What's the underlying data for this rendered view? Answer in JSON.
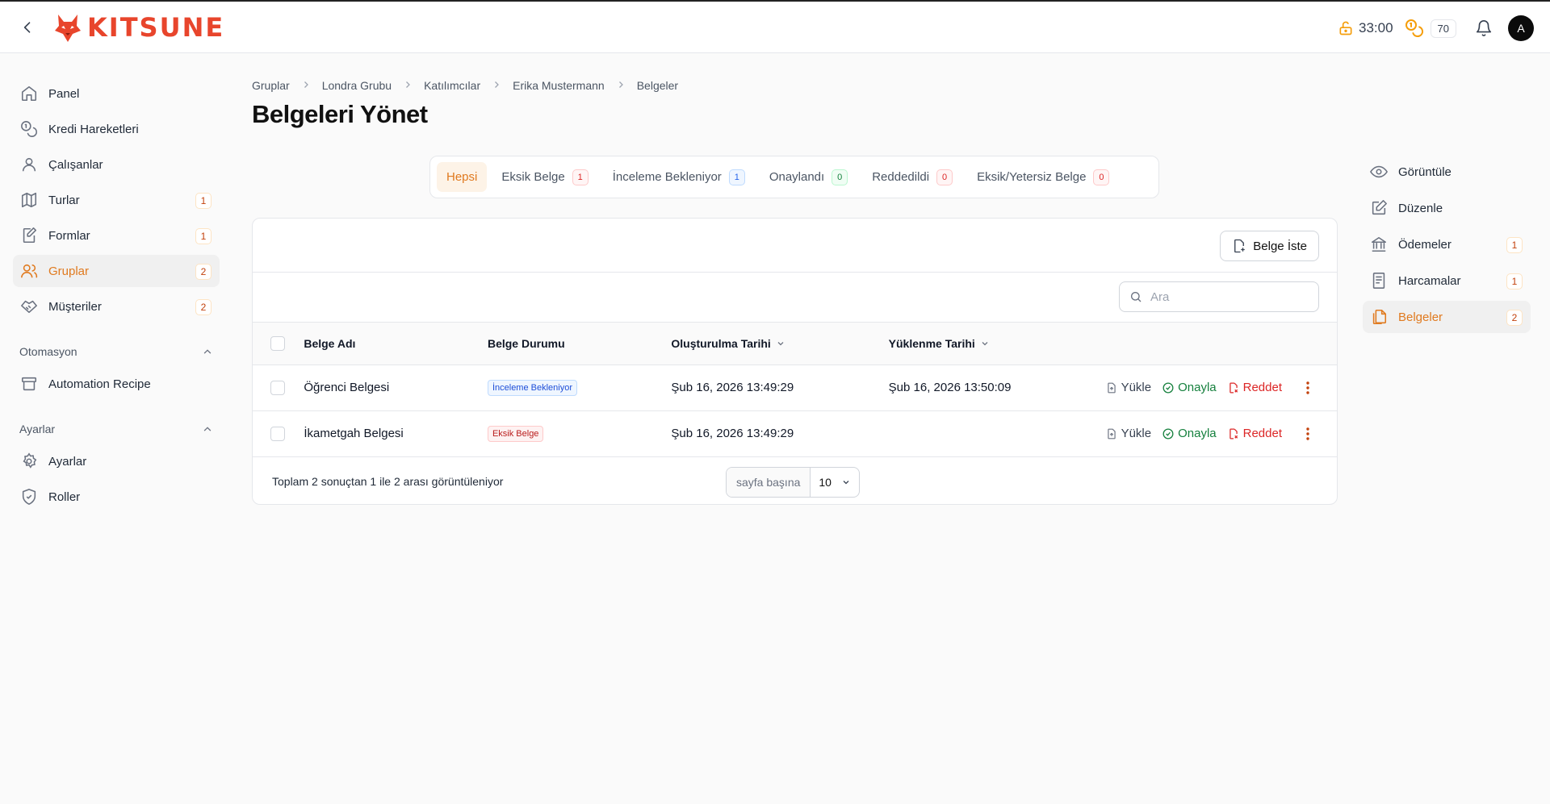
{
  "brand": {
    "name": "KITSUNE",
    "color": "#e8452c"
  },
  "header": {
    "timer": "33:00",
    "credits": "70",
    "avatar_initial": "A"
  },
  "sidebar": {
    "items": [
      {
        "label": "Panel",
        "icon": "home-icon"
      },
      {
        "label": "Kredi Hareketleri",
        "icon": "coins-icon"
      },
      {
        "label": "Çalışanlar",
        "icon": "user-icon"
      },
      {
        "label": "Turlar",
        "icon": "map-icon",
        "badge": "1"
      },
      {
        "label": "Formlar",
        "icon": "form-edit-icon",
        "badge": "1"
      },
      {
        "label": "Gruplar",
        "icon": "users-icon",
        "badge": "2",
        "active": true
      },
      {
        "label": "Müşteriler",
        "icon": "handshake-icon",
        "badge": "2"
      }
    ],
    "automation": {
      "heading": "Otomasyon",
      "items": [
        {
          "label": "Automation Recipe",
          "icon": "archive-icon"
        }
      ]
    },
    "settings": {
      "heading": "Ayarlar",
      "items": [
        {
          "label": "Ayarlar",
          "icon": "gear-icon"
        },
        {
          "label": "Roller",
          "icon": "shield-check-icon"
        }
      ]
    }
  },
  "breadcrumb": [
    "Gruplar",
    "Londra Grubu",
    "Katılımcılar",
    "Erika Mustermann",
    "Belgeler"
  ],
  "page_title": "Belgeleri Yönet",
  "tabs": [
    {
      "label": "Hepsi",
      "active": true
    },
    {
      "label": "Eksik Belge",
      "count": "1",
      "tone": "red"
    },
    {
      "label": "İnceleme Bekleniyor",
      "count": "1",
      "tone": "blue"
    },
    {
      "label": "Onaylandı",
      "count": "0",
      "tone": "green"
    },
    {
      "label": "Reddedildi",
      "count": "0",
      "tone": "red"
    },
    {
      "label": "Eksik/Yetersiz Belge",
      "count": "0",
      "tone": "red"
    }
  ],
  "toolbar": {
    "request_label": "Belge İste",
    "search_placeholder": "Ara"
  },
  "table": {
    "columns": [
      "Belge Adı",
      "Belge Durumu",
      "Oluşturulma Tarihi",
      "Yüklenme Tarihi"
    ],
    "rows": [
      {
        "name": "Öğrenci Belgesi",
        "status": "İnceleme Bekleniyor",
        "status_tone": "blue",
        "created": "Şub 16, 2026 13:49:29",
        "uploaded": "Şub 16, 2026 13:50:09"
      },
      {
        "name": "İkametgah Belgesi",
        "status": "Eksik Belge",
        "status_tone": "red",
        "created": "Şub 16, 2026 13:49:29",
        "uploaded": ""
      }
    ],
    "actions": {
      "upload": "Yükle",
      "approve": "Onayla",
      "reject": "Reddet"
    }
  },
  "footer": {
    "summary": "Toplam 2 sonuçtan 1 ile 2 arası görüntüleniyor",
    "per_page_label": "sayfa başına",
    "per_page_value": "10"
  },
  "right_nav": [
    {
      "label": "Görüntüle",
      "icon": "eye-icon"
    },
    {
      "label": "Düzenle",
      "icon": "edit-icon"
    },
    {
      "label": "Ödemeler",
      "icon": "bank-icon",
      "badge": "1"
    },
    {
      "label": "Harcamalar",
      "icon": "receipt-icon",
      "badge": "1"
    },
    {
      "label": "Belgeler",
      "icon": "documents-icon",
      "badge": "2",
      "active": true
    }
  ],
  "colors": {
    "accent": "#e07a1f",
    "success": "#15803d",
    "danger": "#dc2626",
    "info": "#2563eb"
  }
}
